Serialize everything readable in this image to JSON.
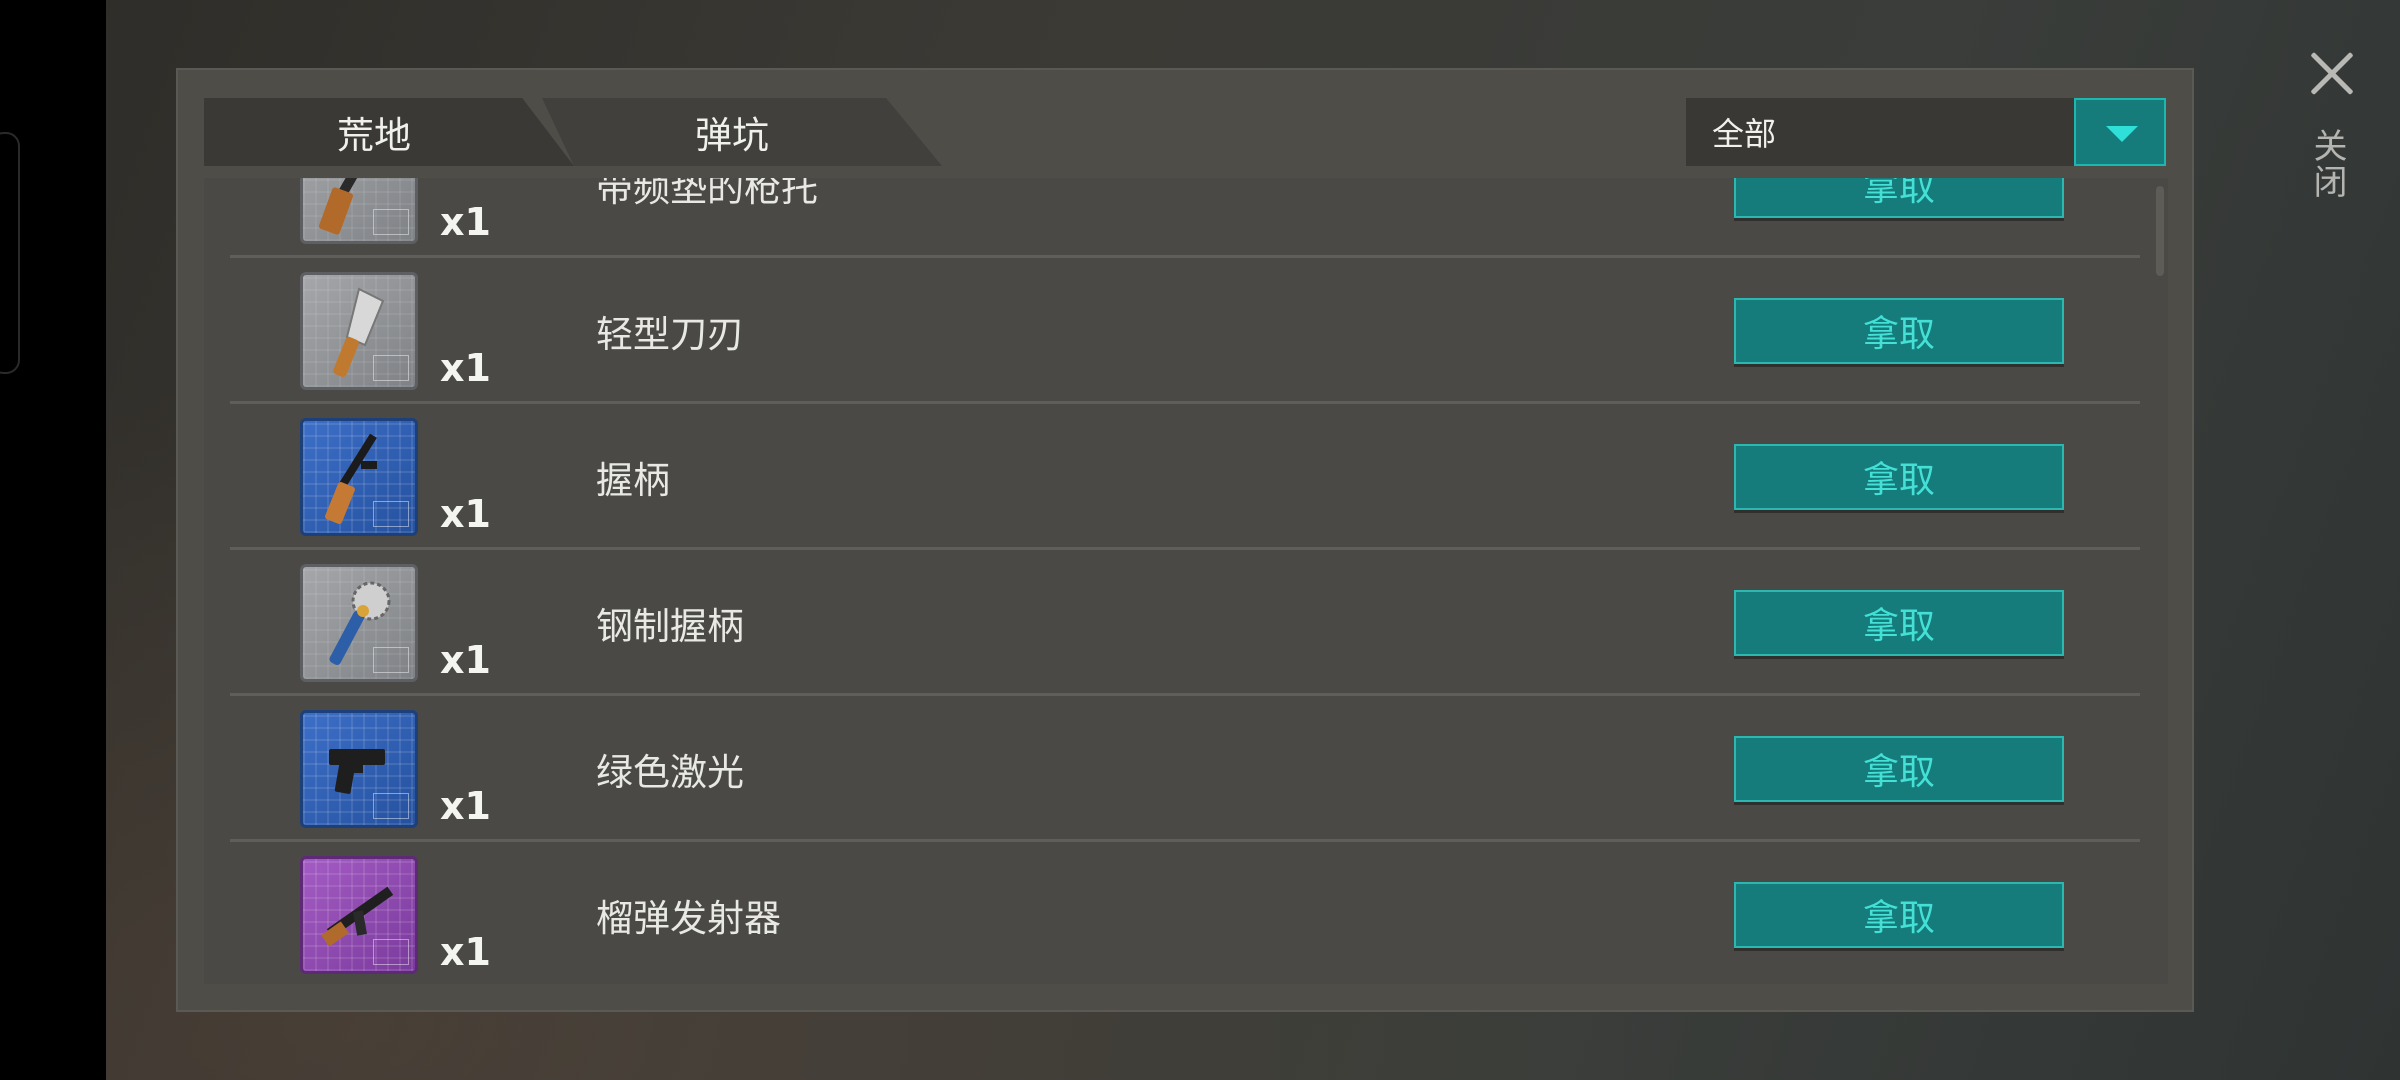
{
  "window": {
    "close_label": "关闭"
  },
  "tabs": [
    {
      "label": "荒地"
    },
    {
      "label": "弹坑"
    }
  ],
  "filter": {
    "selected": "全部"
  },
  "items": [
    {
      "name": "带频垫的枪托",
      "qty": "x1",
      "action": "拿取",
      "card_color": "grey",
      "icon": "rifle-stock-icon"
    },
    {
      "name": "轻型刀刃",
      "qty": "x1",
      "action": "拿取",
      "card_color": "grey",
      "icon": "cleaver-blade-icon"
    },
    {
      "name": "握柄",
      "qty": "x1",
      "action": "拿取",
      "card_color": "blue",
      "icon": "rifle-grip-icon"
    },
    {
      "name": "钢制握柄",
      "qty": "x1",
      "action": "拿取",
      "card_color": "grey",
      "icon": "sawblade-handle-icon"
    },
    {
      "name": "绿色激光",
      "qty": "x1",
      "action": "拿取",
      "card_color": "blue",
      "icon": "pistol-laser-icon"
    },
    {
      "name": "榴弹发射器",
      "qty": "x1",
      "action": "拿取",
      "card_color": "purple",
      "icon": "assault-rifle-icon"
    }
  ],
  "colors": {
    "accent": "#157b7b",
    "accent_text": "#44e0d6"
  }
}
